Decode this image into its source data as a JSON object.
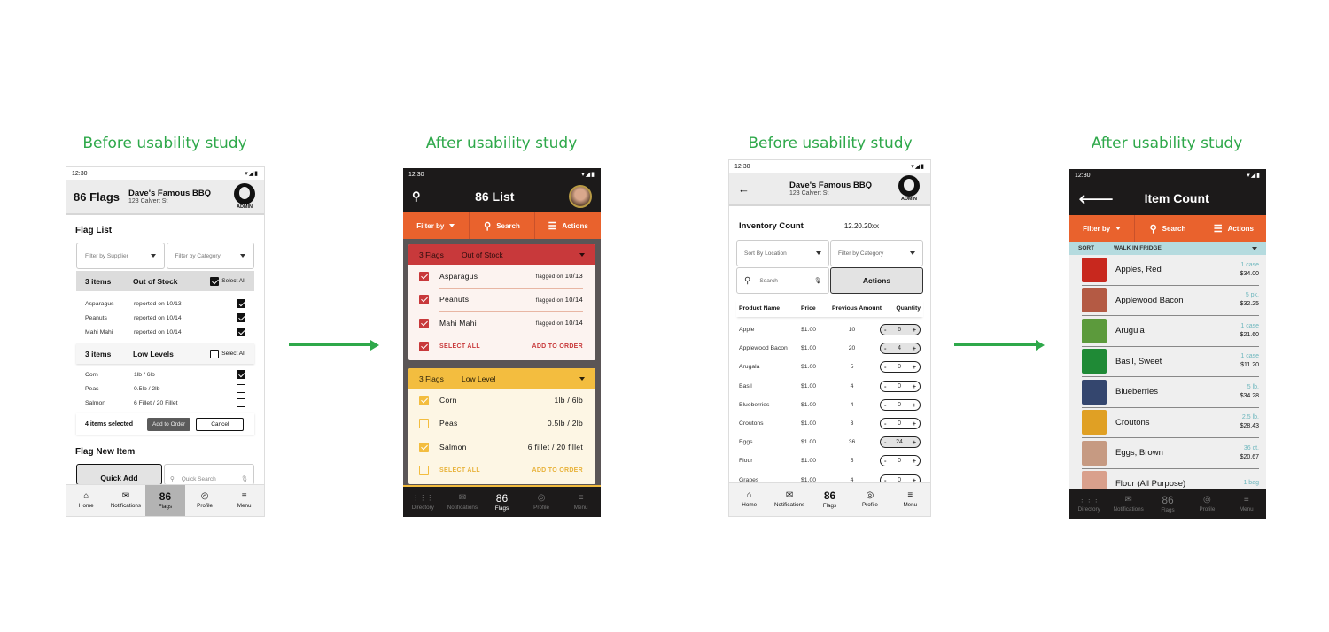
{
  "captions": [
    "Before usability study",
    "After usability study",
    "Before usability study",
    "After usability study"
  ],
  "colors": {
    "accent_green": "#2ea84a",
    "orange": "#e9622d",
    "red": "#c8393b",
    "yellow": "#f3bd3f",
    "dark": "#1c1a1a",
    "teal": "#b5dbdf"
  },
  "status_time": "12:30",
  "status_icons": "▾◢▮",
  "flags_before": {
    "title": "86 Flags",
    "restaurant": "Dave's Famous BBQ",
    "address": "123 Calvert St",
    "role": "ADMIN",
    "section": "Flag List",
    "filter_supplier": "Filter by Supplier",
    "filter_category": "Filter by Category",
    "groups": [
      {
        "count": "3 items",
        "name": "Out of Stock",
        "select_all": "Select All",
        "select_checked": true,
        "items": [
          {
            "name": "Asparagus",
            "info": "reported on 10/13",
            "checked": true
          },
          {
            "name": "Peanuts",
            "info": "reported on 10/14",
            "checked": true
          },
          {
            "name": "Mahi Mahi",
            "info": "reported on 10/14",
            "checked": true
          }
        ]
      },
      {
        "count": "3 items",
        "name": "Low Levels",
        "select_all": "Select All",
        "select_checked": false,
        "items": [
          {
            "name": "Corn",
            "info": "1lb / 6lb",
            "checked": true
          },
          {
            "name": "Peas",
            "info": "0.5lb / 2lb",
            "checked": false
          },
          {
            "name": "Salmon",
            "info": "6 Fillet / 20 Fillet",
            "checked": false
          }
        ]
      }
    ],
    "selected_text": "4 items selected",
    "add_to_order": "Add to Order",
    "cancel": "Cancel",
    "flag_new": "Flag New Item",
    "quick_add": "Quick Add",
    "quick_search": "Quick Search",
    "nav": [
      {
        "icon": "⌂",
        "label": "Home"
      },
      {
        "icon": "✉",
        "label": "Notifications"
      },
      {
        "icon": "86",
        "label": "Flags",
        "active": true
      },
      {
        "icon": "◎",
        "label": "Profile"
      },
      {
        "icon": "≡",
        "label": "Menu"
      }
    ]
  },
  "flags_after": {
    "title": "86 List",
    "toolbar": {
      "filter": "Filter by",
      "search": "Search",
      "actions": "Actions"
    },
    "groups": [
      {
        "count": "3 Flags",
        "name": "Out of Stock",
        "items": [
          {
            "name": "Asparagus",
            "prefix": "flagged on",
            "date": "10/13",
            "checked": true
          },
          {
            "name": "Peanuts",
            "prefix": "flagged on",
            "date": "10/14",
            "checked": true
          },
          {
            "name": "Mahi Mahi",
            "prefix": "flagged on",
            "date": "10/14",
            "checked": true
          }
        ],
        "select_all": "SELECT ALL",
        "select_checked": true,
        "add": "ADD TO ORDER"
      },
      {
        "count": "3 Flags",
        "name": "Low Level",
        "items": [
          {
            "name": "Corn",
            "info": "1lb / 6lb",
            "checked": true
          },
          {
            "name": "Peas",
            "info": "0.5lb / 2lb",
            "checked": false
          },
          {
            "name": "Salmon",
            "info": "6 fillet / 20 fillet",
            "checked": true
          }
        ],
        "select_all": "SELECT ALL",
        "select_checked": false,
        "add": "ADD TO ORDER"
      }
    ],
    "nav": [
      {
        "icon": "⋮⋮⋮",
        "label": "Directory"
      },
      {
        "icon": "✉",
        "label": "Notifications"
      },
      {
        "icon": "86",
        "label": "Flags",
        "active": true
      },
      {
        "icon": "◎",
        "label": "Profile"
      },
      {
        "icon": "≡",
        "label": "Menu"
      }
    ]
  },
  "count_before": {
    "restaurant": "Dave's Famous BBQ",
    "address": "123 Calvert St",
    "role": "ADMIN",
    "heading": "Inventory Count",
    "date": "12.20.20xx",
    "sort": "Sort By Location",
    "filter": "Filter by Category",
    "search": "Search",
    "actions": "Actions",
    "columns": [
      "Product Name",
      "Price",
      "Previous Amount",
      "Quantity"
    ],
    "rows": [
      {
        "name": "Apple",
        "price": "$1.00",
        "prev": "10",
        "qty": "6"
      },
      {
        "name": "Applewood Bacon",
        "price": "$1.00",
        "prev": "20",
        "qty": "4"
      },
      {
        "name": "Arugala",
        "price": "$1.00",
        "prev": "5",
        "qty": "0"
      },
      {
        "name": "Basil",
        "price": "$1.00",
        "prev": "4",
        "qty": "0"
      },
      {
        "name": "Blueberries",
        "price": "$1.00",
        "prev": "4",
        "qty": "0"
      },
      {
        "name": "Croutons",
        "price": "$1.00",
        "prev": "3",
        "qty": "0"
      },
      {
        "name": "Eggs",
        "price": "$1.00",
        "prev": "36",
        "qty": "24"
      },
      {
        "name": "Flour",
        "price": "$1.00",
        "prev": "5",
        "qty": "0"
      },
      {
        "name": "Grapes",
        "price": "$1.00",
        "prev": "4",
        "qty": "0"
      }
    ],
    "nav": [
      {
        "icon": "⌂",
        "label": "Home"
      },
      {
        "icon": "✉",
        "label": "Notifications"
      },
      {
        "icon": "86",
        "label": "Flags"
      },
      {
        "icon": "◎",
        "label": "Profile"
      },
      {
        "icon": "≡",
        "label": "Menu"
      }
    ]
  },
  "count_after": {
    "title": "Item Count",
    "toolbar": {
      "filter": "Filter by",
      "search": "Search",
      "actions": "Actions"
    },
    "sort_label": "SORT",
    "sort_value": "WALK IN FRIDGE",
    "items": [
      {
        "name": "Apples, Red",
        "unit": "1 case",
        "price": "$34.00",
        "thumb": "#c8281e"
      },
      {
        "name": "Applewood Bacon",
        "unit": "5 pk.",
        "price": "$32.25",
        "thumb": "#b45a44"
      },
      {
        "name": "Arugula",
        "unit": "1 case",
        "price": "$21.60",
        "thumb": "#5c9a3c"
      },
      {
        "name": "Basil, Sweet",
        "unit": "1 case",
        "price": "$11.20",
        "thumb": "#1f8a36"
      },
      {
        "name": "Blueberries",
        "unit": "5 lb.",
        "price": "$34.28",
        "thumb": "#34466e"
      },
      {
        "name": "Croutons",
        "unit": "2.5 lb.",
        "price": "$28.43",
        "thumb": "#e0a024"
      },
      {
        "name": "Eggs, Brown",
        "unit": "36 ct.",
        "price": "$20.67",
        "thumb": "#c69a82"
      },
      {
        "name": "Flour (All Purpose)",
        "unit": "1 bag",
        "price": "",
        "thumb": "#d9a08c"
      }
    ],
    "nav": [
      {
        "icon": "⋮⋮⋮",
        "label": "Directory"
      },
      {
        "icon": "✉",
        "label": "Notifications"
      },
      {
        "icon": "86",
        "label": "Flags"
      },
      {
        "icon": "◎",
        "label": "Profile"
      },
      {
        "icon": "≡",
        "label": "Menu"
      }
    ]
  }
}
